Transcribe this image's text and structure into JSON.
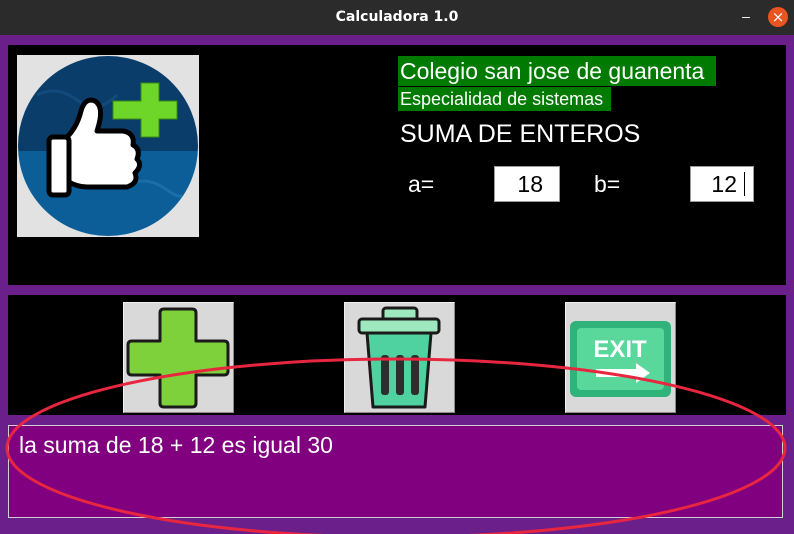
{
  "window": {
    "title": "Calculadora 1.0",
    "minimize_symbol": "–",
    "close_symbol": "×"
  },
  "header": {
    "logo_icon": "thumbs-up-plus-icon",
    "school": "Colegio san jose de guanenta",
    "specialty": "Especialidad de sistemas",
    "heading": "SUMA DE ENTEROS"
  },
  "inputs": {
    "a_label": "a=",
    "a_value": "18",
    "b_label": "b=",
    "b_value": "12"
  },
  "toolbar": {
    "add_icon": "plus-icon",
    "clear_icon": "trash-icon",
    "exit_icon": "exit-sign-icon",
    "exit_text": "EXIT"
  },
  "output": {
    "text": "la suma de 18 + 12 es igual 30"
  },
  "colors": {
    "window_bg": "#6a1f8a",
    "panel_bg": "#000000",
    "label_highlight": "#007a00",
    "result_bg": "#800080",
    "annotation_ellipse": "#e8263f"
  }
}
